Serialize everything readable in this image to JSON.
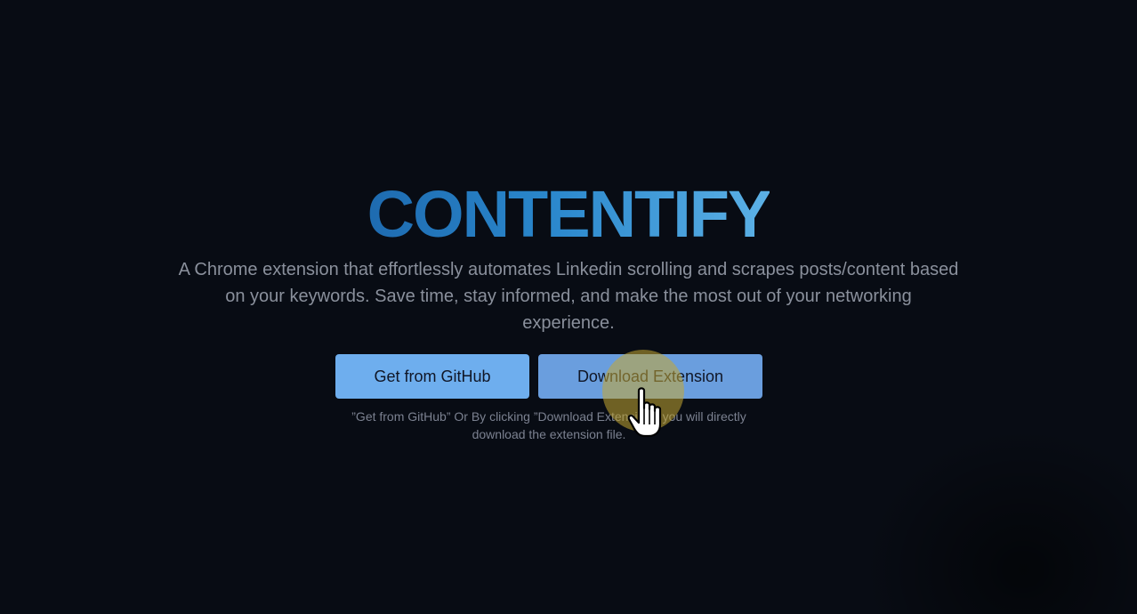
{
  "hero": {
    "title": "CONTENTIFY",
    "description": "A Chrome extension that effortlessly automates Linkedin scrolling and scrapes posts/content based on your keywords. Save time, stay informed, and make the most out of your networking experience."
  },
  "actions": {
    "github_label": "Get from GitHub",
    "download_label": "Download Extension"
  },
  "note": {
    "text": "”Get from GitHub” Or By clicking ”Download Extension”, you will directly download the extension file."
  },
  "colors": {
    "background": "#080c14",
    "title_gradient_start": "#1e6bb0",
    "title_gradient_end": "#5cb1e6",
    "button_primary": "#6eaeee",
    "button_secondary": "#6a9ede",
    "click_highlight": "#c4a832"
  },
  "overlay": {
    "cursor_icon": "hand-pointer-icon"
  }
}
